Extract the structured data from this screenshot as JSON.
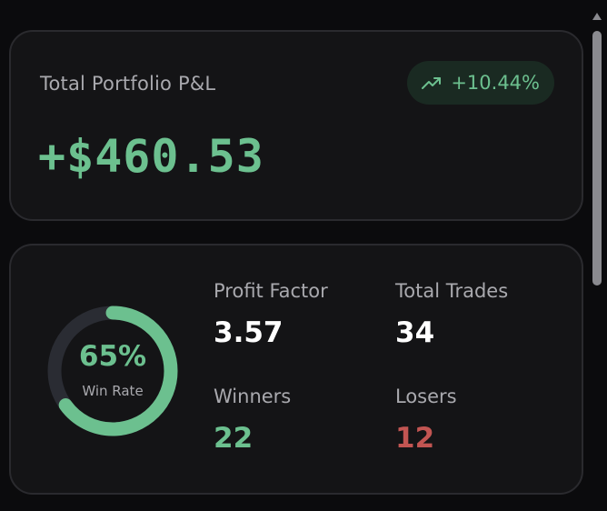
{
  "pnl_card": {
    "label": "Total Portfolio P&L",
    "value": "+$460.53",
    "change_badge": {
      "icon": "trending-up-icon",
      "text": "+10.44%"
    }
  },
  "stats_card": {
    "win_rate": {
      "percent_text": "65%",
      "fraction": 0.65,
      "caption": "Win Rate"
    },
    "profit_factor": {
      "label": "Profit Factor",
      "value": "3.57"
    },
    "total_trades": {
      "label": "Total Trades",
      "value": "34"
    },
    "winners": {
      "label": "Winners",
      "value": "22"
    },
    "losers": {
      "label": "Losers",
      "value": "12"
    }
  },
  "colors": {
    "positive": "#6cc08f",
    "negative": "#c25552",
    "ring_track": "#2a2c33",
    "card_bg": "#141416",
    "page_bg": "#0b0b0d"
  }
}
